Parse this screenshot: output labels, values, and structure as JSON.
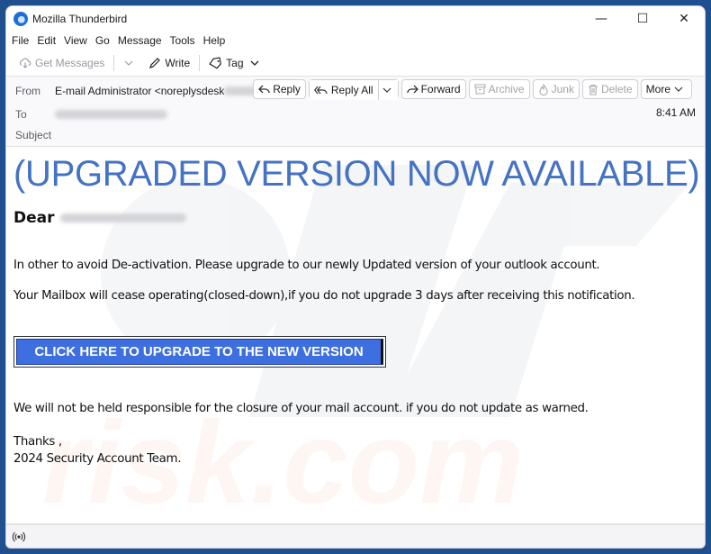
{
  "window": {
    "title": "Mozilla Thunderbird",
    "controls": {
      "minimize": "—",
      "maximize": "☐",
      "close": "✕"
    }
  },
  "menubar": {
    "items": [
      "File",
      "Edit",
      "View",
      "Go",
      "Message",
      "Tools",
      "Help"
    ]
  },
  "toolbar": {
    "get_messages": "Get Messages",
    "write": "Write",
    "tag": "Tag"
  },
  "header": {
    "from_label": "From",
    "from_value": "E-mail Administrator <noreplysdesk",
    "to_label": "To",
    "subject_label": "Subject",
    "time": "8:41 AM",
    "actions": {
      "reply": "Reply",
      "reply_all": "Reply All",
      "forward": "Forward",
      "archive": "Archive",
      "junk": "Junk",
      "delete": "Delete",
      "more": "More"
    }
  },
  "message": {
    "headline": "(UPGRADED VERSION NOW AVAILABLE)",
    "greeting": "Dear",
    "paragraph1": "In other to avoid De-activation. Please upgrade to our newly Updated  version of your outlook account.",
    "paragraph2": "Your Mailbox will cease operating(closed-down),if you do not upgrade 3 days after receiving this notification.",
    "cta_label": "CLICK HERE TO UPGRADE TO THE NEW VERSION",
    "paragraph3": "We will not be held responsible for the closure of your mail account. if you do not update as warned.",
    "signoff": "Thanks ,",
    "signature": "2024 Security Account Team."
  },
  "colors": {
    "headline": "#4472c4",
    "cta_background": "#3d6fe0",
    "desktop": "#1f4f8f"
  }
}
